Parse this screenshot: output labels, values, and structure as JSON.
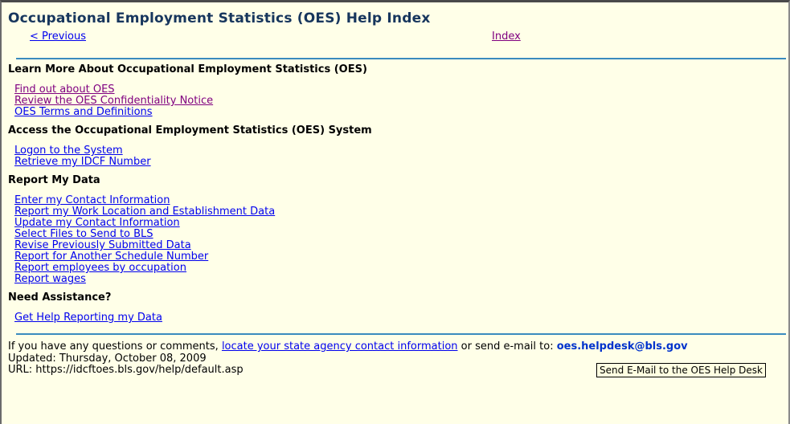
{
  "page": {
    "title": "Occupational Employment Statistics (OES) Help Index",
    "nav": {
      "previous_label": "< Previous",
      "index_label": "Index"
    }
  },
  "sections": [
    {
      "heading": "Learn More About Occupational Employment Statistics (OES)",
      "links": [
        {
          "label": "Find out about OES",
          "visited": true
        },
        {
          "label": "Review the OES Confidentiality Notice",
          "visited": true
        },
        {
          "label": "OES Terms and Definitions",
          "visited": false
        }
      ]
    },
    {
      "heading": "Access the Occupational Employment Statistics (OES) System",
      "links": [
        {
          "label": "Logon to the System",
          "visited": false
        },
        {
          "label": "Retrieve my IDCF Number",
          "visited": false
        }
      ]
    },
    {
      "heading": "Report My Data",
      "links": [
        {
          "label": "Enter my Contact Information",
          "visited": false
        },
        {
          "label": "Report my Work Location and Establishment Data",
          "visited": false
        },
        {
          "label": "Update my Contact Information",
          "visited": false
        },
        {
          "label": "Select Files to Send to BLS",
          "visited": false
        },
        {
          "label": "Revise Previously Submitted Data",
          "visited": false
        },
        {
          "label": "Report for Another Schedule Number",
          "visited": false
        },
        {
          "label": "Report employees by occupation",
          "visited": false
        },
        {
          "label": "Report wages",
          "visited": false
        }
      ]
    },
    {
      "heading": "Need Assistance?",
      "links": [
        {
          "label": "Get Help Reporting my Data",
          "visited": false
        }
      ]
    }
  ],
  "footer": {
    "question_prefix": "If you have any questions or comments, ",
    "contact_link": "locate your state agency contact information",
    "question_middle": " or send e-mail to: ",
    "email": "oes.helpdesk@bls.gov",
    "updated": "Updated: Thursday, October 08, 2009",
    "url": "URL: https://idcftoes.bls.gov/help/default.asp",
    "tooltip": "Send E-Mail to the OES Help Desk"
  },
  "colors": {
    "background": "#FFFFE8",
    "title": "#17365D",
    "link_unvisited": "#0000EE",
    "link_visited": "#800080",
    "rule": "#3A8BBE",
    "email": "#0033CC",
    "tooltip_bg": "#FFFFE1"
  }
}
